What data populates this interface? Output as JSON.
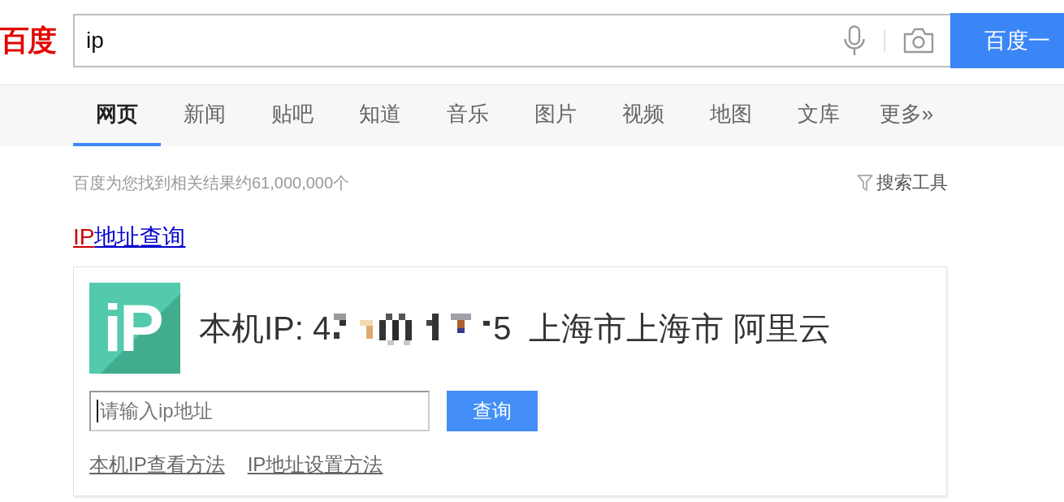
{
  "header": {
    "logo": "百度",
    "search": {
      "value": "ip"
    },
    "search_button": "百度一"
  },
  "tabs": [
    {
      "label": "网页",
      "selected": true
    },
    {
      "label": "新闻",
      "selected": false
    },
    {
      "label": "贴吧",
      "selected": false
    },
    {
      "label": "知道",
      "selected": false
    },
    {
      "label": "音乐",
      "selected": false
    },
    {
      "label": "图片",
      "selected": false
    },
    {
      "label": "视频",
      "selected": false
    },
    {
      "label": "地图",
      "selected": false
    },
    {
      "label": "文库",
      "selected": false
    },
    {
      "label": "更多»",
      "selected": false
    }
  ],
  "result_stats": "百度为您找到相关结果约61,000,000个",
  "search_tools": "搜索工具",
  "result": {
    "title_parts": [
      {
        "text": "IP",
        "highlighted": true
      },
      {
        "text": "地址查询",
        "highlighted": false
      }
    ],
    "card": {
      "logo_text": "iP",
      "ip_label": "本机IP:",
      "ip_visible_start": "4",
      "ip_visible_end": "5",
      "location": "上海市上海市 阿里云",
      "input": {
        "placeholder": "请输入ip地址",
        "focused": true
      },
      "button": "查询",
      "links": [
        "本机IP查看方法",
        "IP地址设置方法"
      ]
    }
  }
}
